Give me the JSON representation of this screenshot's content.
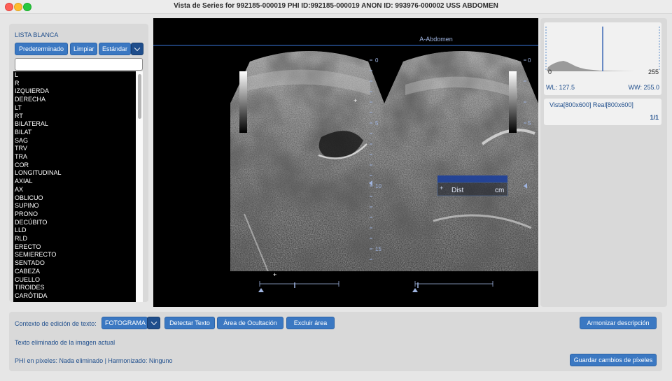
{
  "window": {
    "title": "Vista de Series for 992185-000019 PHI ID:992185-000019 ANON ID: 993976-000002 USS ABDOMEN"
  },
  "whitelist": {
    "title": "LISTA BLANCA",
    "buttons": {
      "default_label": "Predeterminado",
      "clear_label": "Limpiar",
      "standard_label": "Estándar"
    },
    "filter_value": "",
    "items": [
      "L",
      "R",
      "IZQUIERDA",
      "DERECHA",
      "LT",
      "RT",
      "BILATERAL",
      "BILAT",
      "SAG",
      "TRV",
      "TRA",
      "COR",
      "LONGITUDINAL",
      "AXIAL",
      "AX",
      "OBLICUO",
      "SUPINO",
      "PRONO",
      "DECÚBITO",
      "LLD",
      "RLD",
      "ERECTO",
      "SEMIERECTO",
      "SENTADO",
      "CABEZA",
      "CUELLO",
      "TIROIDES",
      "CARÓTIDA"
    ]
  },
  "image": {
    "header": "A-Abdomen",
    "depth_ticks": [
      "0",
      "5",
      "10",
      "15"
    ],
    "right_depth_ticks": [
      "0",
      "5"
    ],
    "measurement_label": "Dist",
    "measurement_unit": "cm",
    "colors": {
      "overlay": "#9fb4e0",
      "header_line": "#2f5fb0",
      "measure_bar": "#1d3f9a"
    }
  },
  "histogram": {
    "min_label": "0",
    "max_label": "255",
    "marker_value": 127.5,
    "wl_label": "WL: 127.5",
    "ww_label": "WW: 255.0"
  },
  "view_info": {
    "dims_label": "Vista[800x600] Real[800x600]",
    "frame_counter": "1/1"
  },
  "bottom": {
    "context_label": "Contexto de edición de texto:",
    "context_value": "FOTOGRAMA",
    "detect_text_label": "Detectar Texto",
    "hide_area_label": "Área de Ocultación",
    "exclude_area_label": "Excluir área",
    "harmonize_label": "Armonizar descripción",
    "removed_text_label": "Texto eliminado de la imagen actual",
    "phi_status": "PHI en píxeles: Nada eliminado | Harmonizado: Ninguno",
    "save_label": "Guardar cambios de píxeles"
  }
}
